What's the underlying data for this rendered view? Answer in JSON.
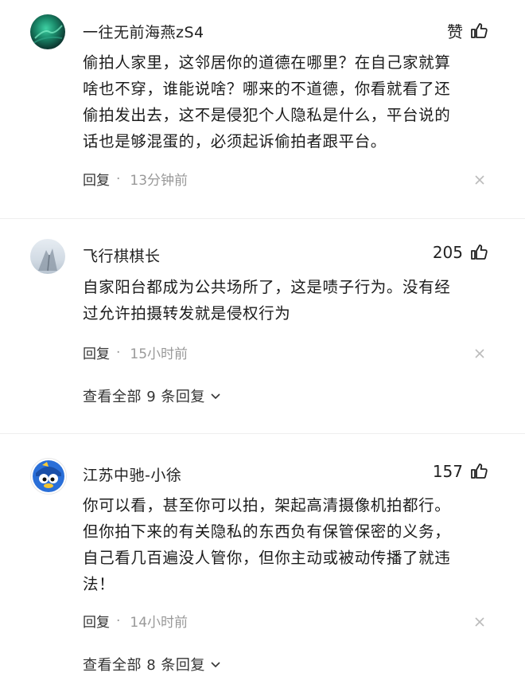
{
  "comments": [
    {
      "username": "一往无前海燕zS4",
      "like_label": "赞",
      "lines": [
        "偷拍人家里，这邻居你的道德在哪里？在自己家就算",
        "啥也不穿，谁能说啥？哪来的不道德，你看就看了还",
        "偷拍发出去，这不是侵犯个人隐私是什么，平台说的",
        "话也是够混蛋的，必须起诉偷拍者跟平台。"
      ],
      "reply": "回复",
      "time": "13分钟前"
    },
    {
      "username": "飞行棋棋长",
      "like_count": "205",
      "lines": [
        "自家阳台都成为公共场所了，这是啧子行为。没有经",
        "过允许拍摄转发就是侵权行为"
      ],
      "reply": "回复",
      "time": "15小时前",
      "more_replies": "查看全部 9 条回复"
    },
    {
      "username": "江苏中驰-小徐",
      "like_count": "157",
      "lines": [
        "你可以看，甚至你可以拍，架起高清摄像机拍都行。",
        "但你拍下来的有关隐私的东西负有保管保密的义务，",
        "自己看几百遍没人管你，但你主动或被动传播了就违",
        "法！"
      ],
      "reply": "回复",
      "time": "14小时前",
      "more_replies": "查看全部 8 条回复"
    }
  ],
  "icons": {
    "like": "thumbs-up-icon",
    "close": "close-icon",
    "expand": "chevron-down-icon"
  }
}
